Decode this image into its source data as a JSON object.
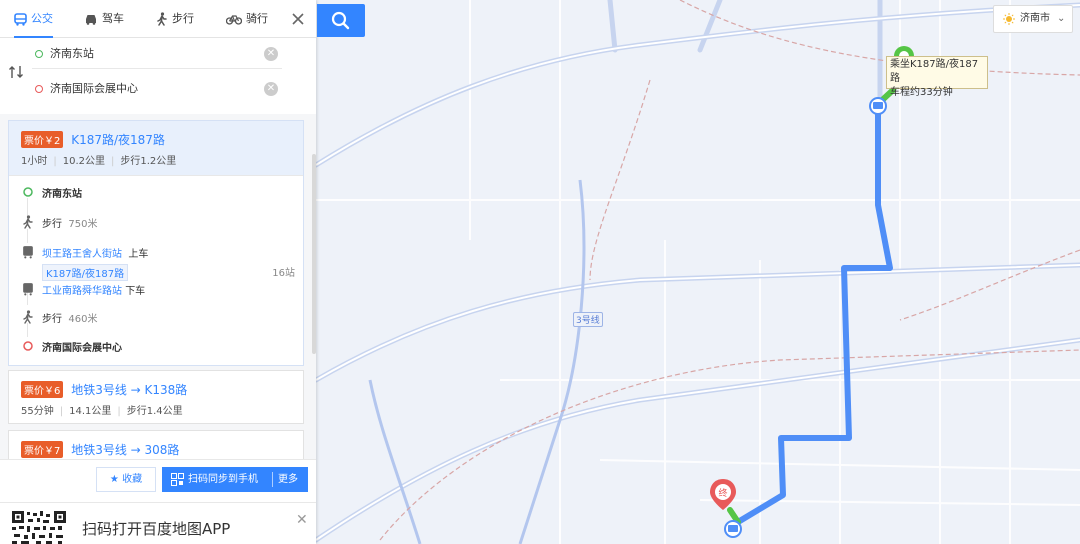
{
  "modes": [
    {
      "label": "公交",
      "icon": "bus-icon",
      "active": true
    },
    {
      "label": "驾车",
      "icon": "car-icon",
      "active": false
    },
    {
      "label": "步行",
      "icon": "walk-icon",
      "active": false
    },
    {
      "label": "骑行",
      "icon": "bike-icon",
      "active": false
    }
  ],
  "search": {
    "start": "济南东站",
    "end": "济南国际会展中心"
  },
  "routes": [
    {
      "fare": "票价￥2",
      "title": "K187路/夜187路",
      "duration": "1小时",
      "distance": "10.2公里",
      "walk": "步行1.2公里"
    },
    {
      "fare": "票价￥6",
      "title": "地铁3号线 → K138路",
      "duration": "55分钟",
      "distance": "14.1公里",
      "walk": "步行1.4公里"
    },
    {
      "fare": "票价￥7",
      "title": "地铁3号线 → 308路"
    }
  ],
  "steps": {
    "start": "济南东站",
    "walk1": "步行",
    "walk1_dist": "750米",
    "board_stop": "坝王路王舍人街站",
    "board_action": "上车",
    "line": "K187路/夜187路",
    "stops": "16站",
    "alight_stop": "工业南路舜华路站",
    "alight_action": "下车",
    "walk2": "步行",
    "walk2_dist": "460米",
    "end": "济南国际会展中心"
  },
  "actions": {
    "fav": "收藏",
    "sync": "扫码同步到手机",
    "more": "更多"
  },
  "appbar": {
    "text": "扫码打开百度地图APP",
    "close": "✕"
  },
  "city": {
    "name": "济南市"
  },
  "map": {
    "tip_line1": "乘坐K187路/夜187路",
    "tip_line2": "车程约33分钟",
    "metro_label": "3号线",
    "end_marker": "终",
    "route_color": "#4f8ef7"
  },
  "colors": {
    "accent": "#3385ff",
    "fare": "#e85d29",
    "start": "#4cb85e",
    "end": "#e85a5a"
  }
}
